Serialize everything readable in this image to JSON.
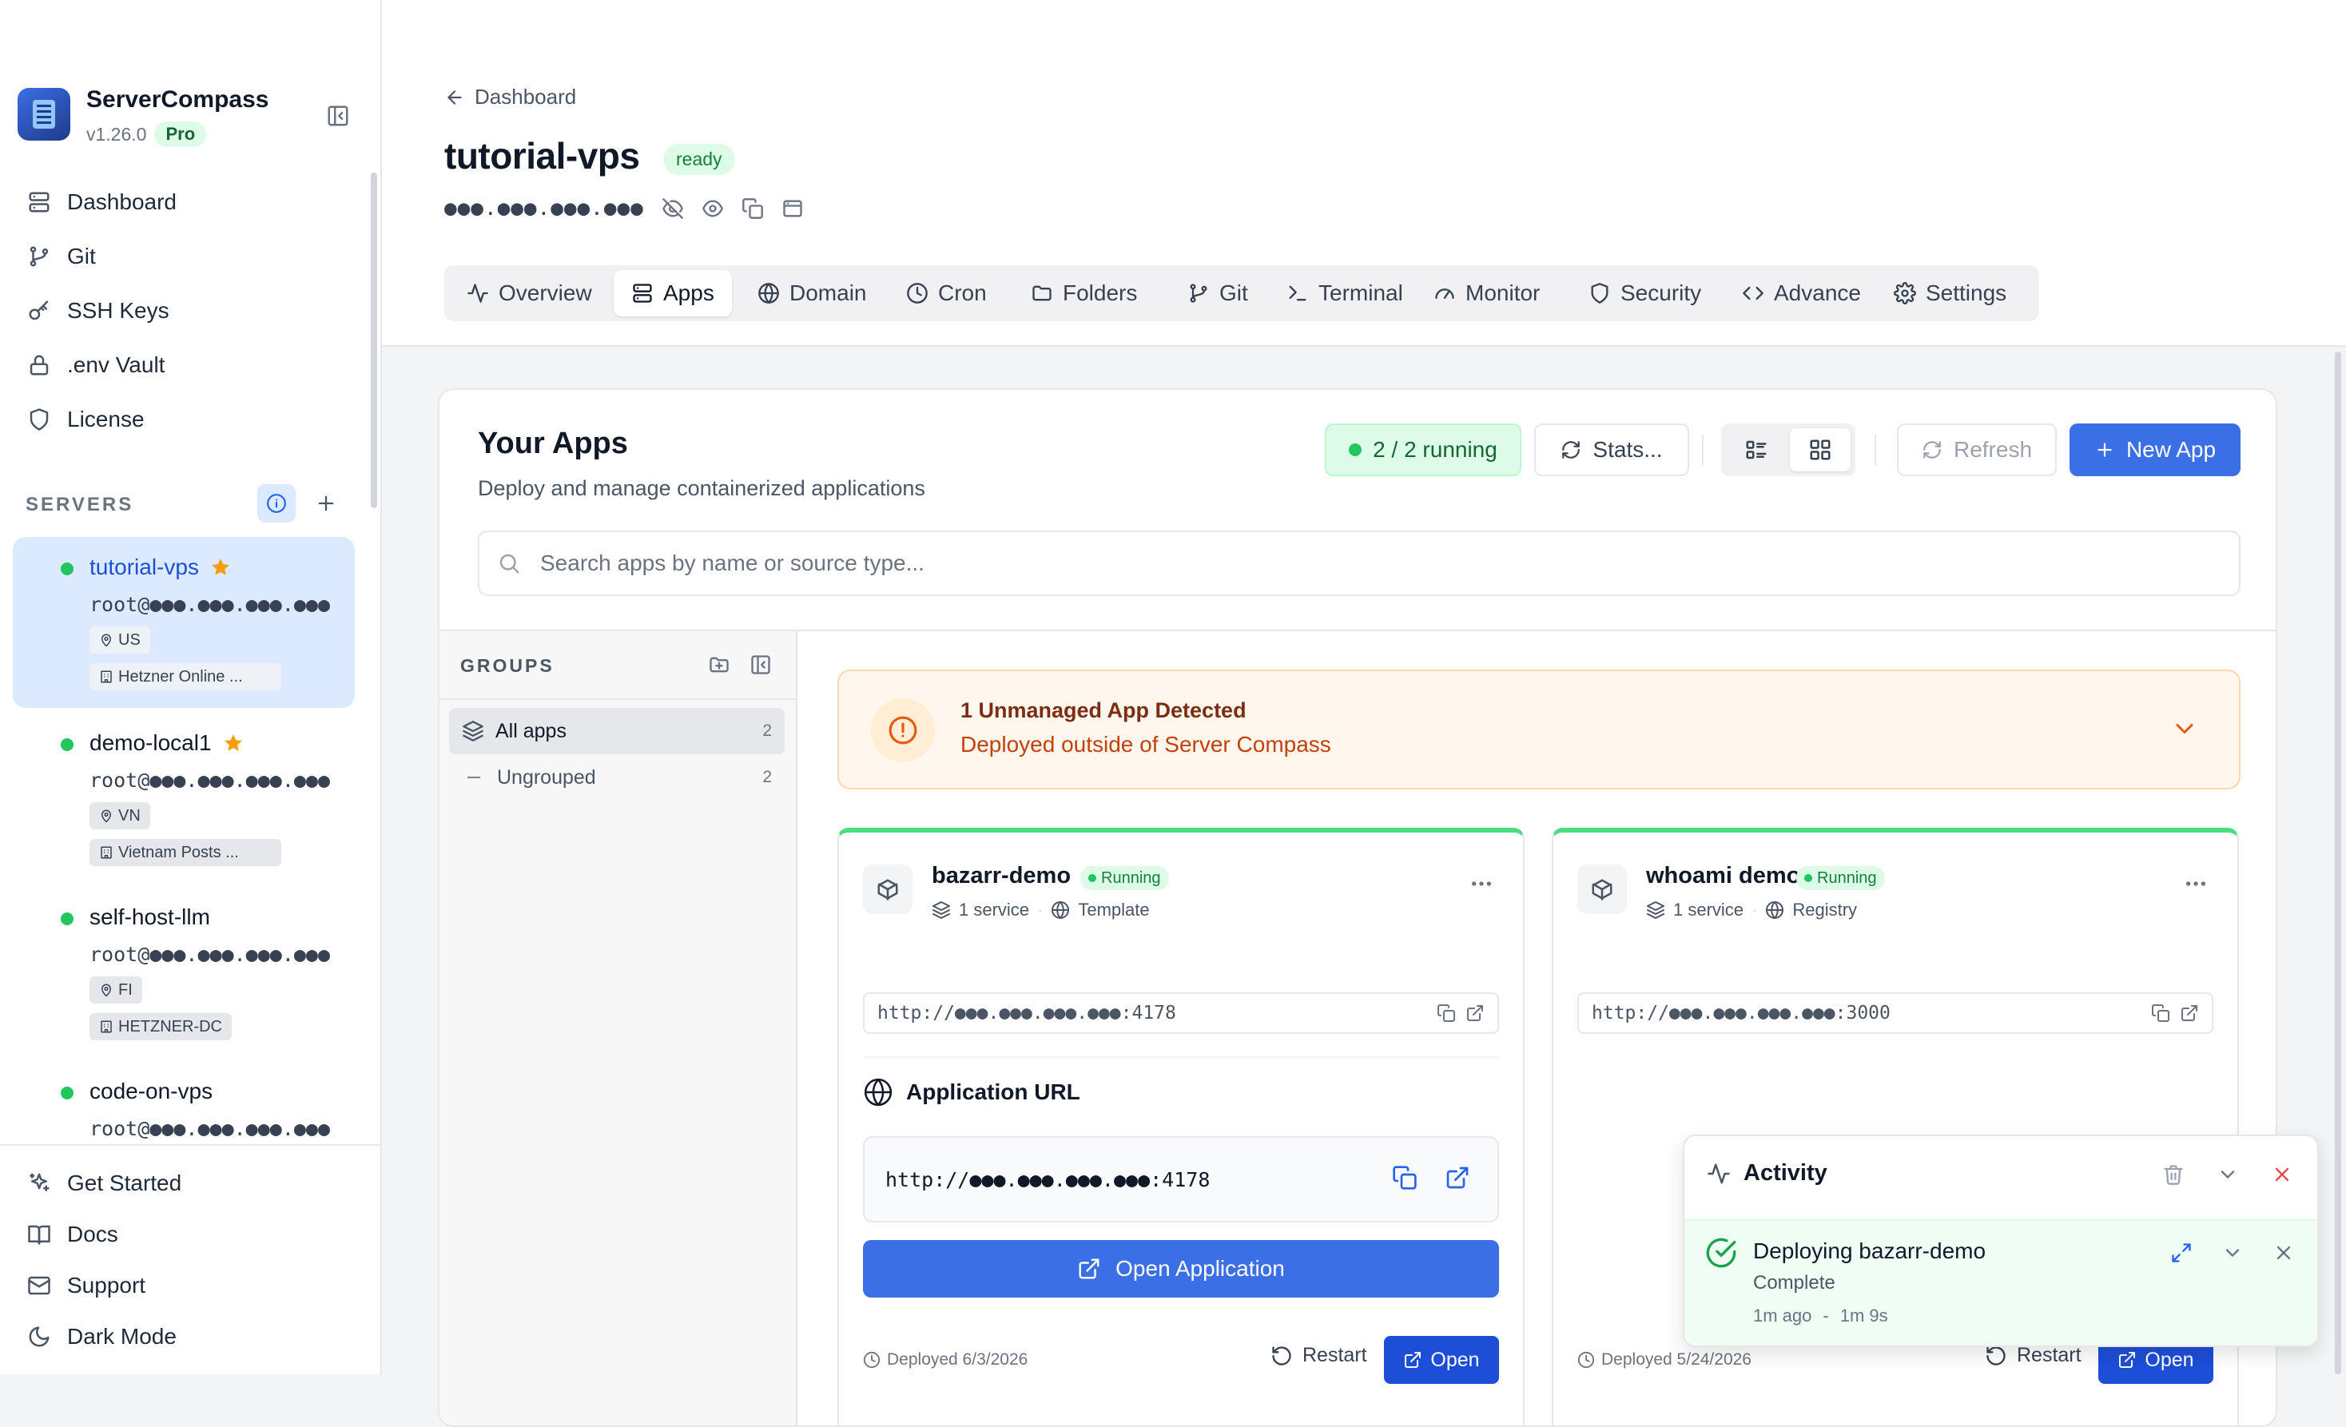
{
  "sidebar": {
    "brand": {
      "name": "ServerCompass",
      "version": "v1.26.0",
      "plan": "Pro"
    },
    "nav": [
      {
        "label": "Dashboard",
        "icon": "server-icon"
      },
      {
        "label": "Git",
        "icon": "git-branch-icon"
      },
      {
        "label": "SSH Keys",
        "icon": "key-icon"
      },
      {
        "label": ".env Vault",
        "icon": "lock-icon"
      },
      {
        "label": "License",
        "icon": "shield-icon"
      }
    ],
    "servers_label": "SERVERS",
    "servers": [
      {
        "name": "tutorial-vps",
        "user": "root@●●●.●●●.●●●.●●●",
        "region": "US",
        "provider": "Hetzner Online ...",
        "starred": true,
        "active": true
      },
      {
        "name": "demo-local1",
        "user": "root@●●●.●●●.●●●.●●●",
        "region": "VN",
        "provider": "Vietnam Posts ...",
        "starred": true,
        "active": false
      },
      {
        "name": "self-host-llm",
        "user": "root@●●●.●●●.●●●.●●●",
        "region": "FI",
        "provider": "HETZNER-DC",
        "starred": false,
        "active": false
      },
      {
        "name": "code-on-vps",
        "user": "root@●●●.●●●.●●●.●●●",
        "starred": false,
        "active": false
      }
    ],
    "bottom": [
      {
        "label": "Get Started",
        "icon": "sparkle-icon"
      },
      {
        "label": "Docs",
        "icon": "book-icon"
      },
      {
        "label": "Support",
        "icon": "mail-icon"
      },
      {
        "label": "Dark Mode",
        "icon": "moon-icon"
      }
    ]
  },
  "header": {
    "back_label": "Dashboard",
    "title": "tutorial-vps",
    "status": "ready",
    "ip_masked": "●●●.●●●.●●●.●●●",
    "tabs": [
      {
        "label": "Overview",
        "icon": "activity-icon"
      },
      {
        "label": "Apps",
        "icon": "server-icon",
        "active": true
      },
      {
        "label": "Domain",
        "icon": "globe-icon"
      },
      {
        "label": "Cron",
        "icon": "clock-icon"
      },
      {
        "label": "Folders",
        "icon": "folder-icon"
      },
      {
        "label": "Git",
        "icon": "git-branch-icon"
      },
      {
        "label": "Terminal",
        "icon": "terminal-icon"
      },
      {
        "label": "Monitor",
        "icon": "gauge-icon"
      },
      {
        "label": "Security",
        "icon": "shield-icon"
      },
      {
        "label": "Advance",
        "icon": "code-icon"
      },
      {
        "label": "Settings",
        "icon": "gear-icon"
      }
    ]
  },
  "apps_panel": {
    "title": "Your Apps",
    "subtitle": "Deploy and manage containerized applications",
    "running": "2 / 2 running",
    "stats_label": "Stats...",
    "refresh_label": "Refresh",
    "new_app_label": "New App",
    "search_placeholder": "Search apps by name or source type...",
    "groups": {
      "label": "GROUPS",
      "items": [
        {
          "label": "All apps",
          "count": "2",
          "active": true
        },
        {
          "label": "Ungrouped",
          "count": "2",
          "active": false
        }
      ]
    },
    "banner": {
      "title": "1 Unmanaged App Detected",
      "subtitle": "Deployed outside of Server Compass"
    },
    "apps": [
      {
        "name": "bazarr-demo",
        "status": "Running",
        "services": "1 service",
        "source": "Template",
        "url": "http://●●●.●●●.●●●.●●●:4178",
        "app_url_title": "Application URL",
        "app_url": "http://●●●.●●●.●●●.●●●:4178",
        "open_app_label": "Open Application",
        "deployed": "Deployed 6/3/2026",
        "restart_label": "Restart",
        "open_label": "Open"
      },
      {
        "name": "whoami demo",
        "status": "Running",
        "services": "1 service",
        "source": "Registry",
        "url": "http://●●●.●●●.●●●.●●●:3000",
        "deployed": "Deployed 5/24/2026",
        "restart_label": "Restart",
        "open_label": "Open"
      }
    ]
  },
  "activity": {
    "title": "Activity",
    "item": {
      "title": "Deploying bazarr-demo",
      "status": "Complete",
      "ago": "1m ago",
      "sep": "-",
      "duration": "1m 9s"
    }
  },
  "colors": {
    "accent": "#3b6fe6",
    "running": "#22c55e",
    "warning": "#ea580c",
    "danger": "#ef4444"
  }
}
